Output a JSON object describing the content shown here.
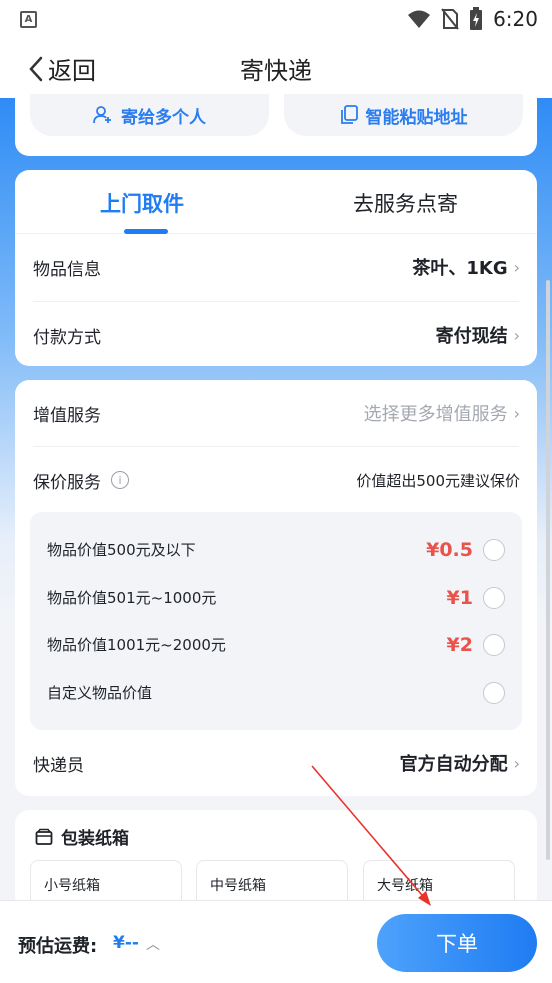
{
  "status_bar": {
    "time": "6:20",
    "app_icon_letter": "A"
  },
  "nav": {
    "back_label": "返回",
    "title": "寄快递"
  },
  "top_actions": {
    "multi_send": "寄给多个人",
    "smart_paste": "智能粘贴地址"
  },
  "tabs": {
    "active": "上门取件",
    "inactive": "去服务点寄"
  },
  "item_info": {
    "label": "物品信息",
    "value": "茶叶、1KG"
  },
  "payment": {
    "label": "付款方式",
    "value": "寄付现结"
  },
  "value_added": {
    "label": "增值服务",
    "value": "选择更多增值服务"
  },
  "insurance": {
    "label": "保价服务",
    "note": "价值超出500元建议保价",
    "options": [
      {
        "label": "物品价值500元及以下",
        "price": "¥0.5"
      },
      {
        "label": "物品价值501元~1000元",
        "price": "¥1"
      },
      {
        "label": "物品价值1001元~2000元",
        "price": "¥2"
      },
      {
        "label": "自定义物品价值",
        "price": ""
      }
    ]
  },
  "courier": {
    "label": "快递员",
    "value": "官方自动分配"
  },
  "packaging": {
    "title": "包装纸箱",
    "items": [
      "小号纸箱",
      "中号纸箱",
      "大号纸箱"
    ]
  },
  "footer": {
    "fee_label": "预估运费:",
    "fee_value": "¥--",
    "order_button": "下单"
  },
  "colors": {
    "accent": "#1f7cf2",
    "price": "#e9534b",
    "annotation_arrow": "#e8332a"
  }
}
